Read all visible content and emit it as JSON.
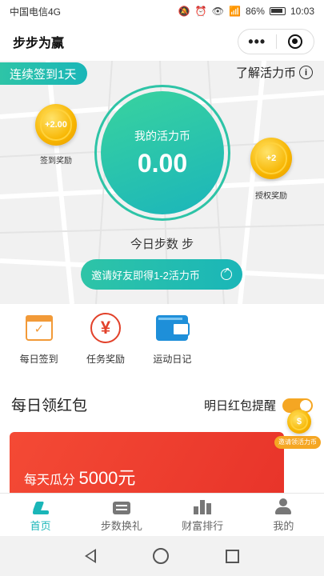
{
  "status_bar": {
    "carrier": "中国电信4G",
    "battery": "86%",
    "time": "10:03"
  },
  "header": {
    "title": "步步为赢"
  },
  "hero": {
    "streak_badge": "连续签到1天",
    "learn_coins_link": "了解活力币",
    "signin_coin_value": "+2.00",
    "signin_coin_caption": "签到奖励",
    "auth_coin_value": "+2",
    "auth_coin_caption": "授权奖励",
    "coins_label": "我的活力币",
    "coins_value": "0.00",
    "steps_today": "今日步数 步",
    "invite_button": "邀请好友即得1-2活力币"
  },
  "actions": [
    {
      "label": "每日签到",
      "icon": "calendar-check-icon"
    },
    {
      "label": "任务奖励",
      "icon": "yen-icon"
    },
    {
      "label": "运动日记",
      "icon": "wallet-icon"
    }
  ],
  "red_packet": {
    "title": "每日领红包",
    "reminder_label": "明日红包提醒",
    "reminder_on": true,
    "invite_tag": "邀请领活力币",
    "card_prefix": "每天瓜分",
    "card_amount": "5000元"
  },
  "tabbar": [
    {
      "label": "首页",
      "active": true,
      "icon": "shoe-icon"
    },
    {
      "label": "步数换礼",
      "active": false,
      "icon": "ticket-icon"
    },
    {
      "label": "财富排行",
      "active": false,
      "icon": "bar-chart-icon"
    },
    {
      "label": "我的",
      "active": false,
      "icon": "person-icon"
    }
  ],
  "colors": {
    "accent": "#1ab6b8",
    "coin": "#f7b500",
    "red_packet": "#e8342a"
  }
}
